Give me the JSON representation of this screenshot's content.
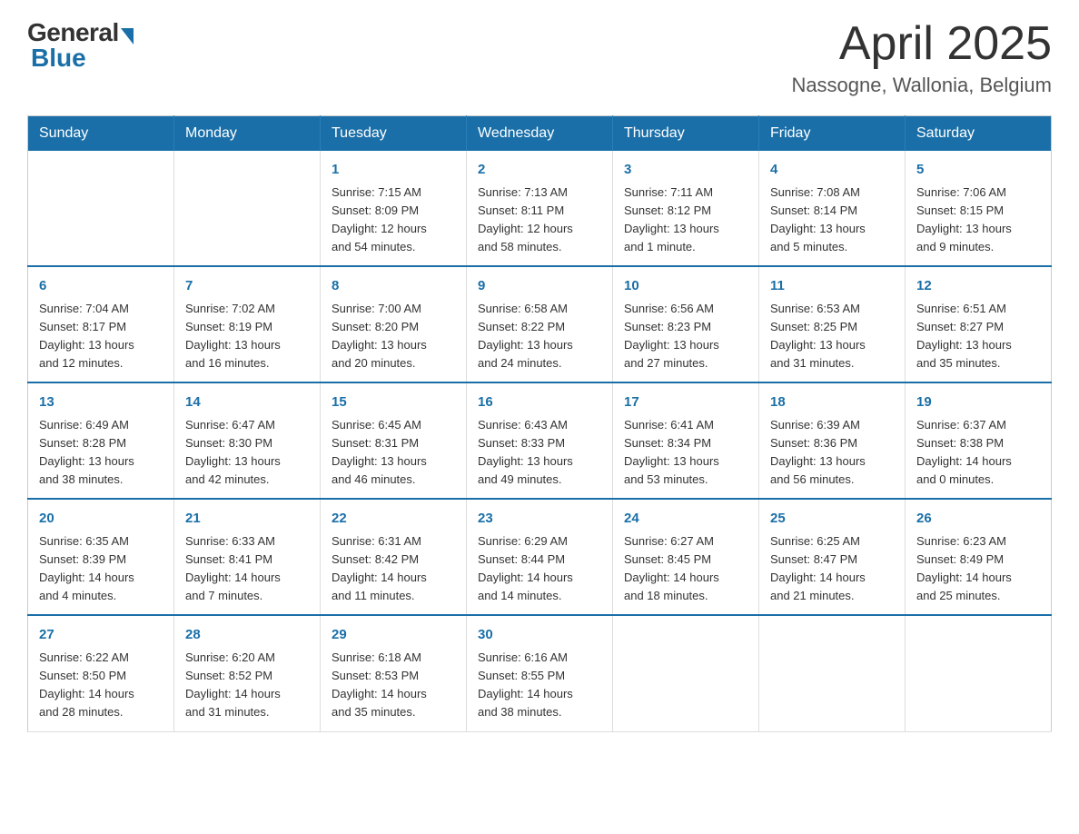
{
  "logo": {
    "general": "General",
    "blue": "Blue"
  },
  "title": "April 2025",
  "location": "Nassogne, Wallonia, Belgium",
  "weekdays": [
    "Sunday",
    "Monday",
    "Tuesday",
    "Wednesday",
    "Thursday",
    "Friday",
    "Saturday"
  ],
  "weeks": [
    [
      {
        "day": "",
        "info": ""
      },
      {
        "day": "",
        "info": ""
      },
      {
        "day": "1",
        "info": "Sunrise: 7:15 AM\nSunset: 8:09 PM\nDaylight: 12 hours\nand 54 minutes."
      },
      {
        "day": "2",
        "info": "Sunrise: 7:13 AM\nSunset: 8:11 PM\nDaylight: 12 hours\nand 58 minutes."
      },
      {
        "day": "3",
        "info": "Sunrise: 7:11 AM\nSunset: 8:12 PM\nDaylight: 13 hours\nand 1 minute."
      },
      {
        "day": "4",
        "info": "Sunrise: 7:08 AM\nSunset: 8:14 PM\nDaylight: 13 hours\nand 5 minutes."
      },
      {
        "day": "5",
        "info": "Sunrise: 7:06 AM\nSunset: 8:15 PM\nDaylight: 13 hours\nand 9 minutes."
      }
    ],
    [
      {
        "day": "6",
        "info": "Sunrise: 7:04 AM\nSunset: 8:17 PM\nDaylight: 13 hours\nand 12 minutes."
      },
      {
        "day": "7",
        "info": "Sunrise: 7:02 AM\nSunset: 8:19 PM\nDaylight: 13 hours\nand 16 minutes."
      },
      {
        "day": "8",
        "info": "Sunrise: 7:00 AM\nSunset: 8:20 PM\nDaylight: 13 hours\nand 20 minutes."
      },
      {
        "day": "9",
        "info": "Sunrise: 6:58 AM\nSunset: 8:22 PM\nDaylight: 13 hours\nand 24 minutes."
      },
      {
        "day": "10",
        "info": "Sunrise: 6:56 AM\nSunset: 8:23 PM\nDaylight: 13 hours\nand 27 minutes."
      },
      {
        "day": "11",
        "info": "Sunrise: 6:53 AM\nSunset: 8:25 PM\nDaylight: 13 hours\nand 31 minutes."
      },
      {
        "day": "12",
        "info": "Sunrise: 6:51 AM\nSunset: 8:27 PM\nDaylight: 13 hours\nand 35 minutes."
      }
    ],
    [
      {
        "day": "13",
        "info": "Sunrise: 6:49 AM\nSunset: 8:28 PM\nDaylight: 13 hours\nand 38 minutes."
      },
      {
        "day": "14",
        "info": "Sunrise: 6:47 AM\nSunset: 8:30 PM\nDaylight: 13 hours\nand 42 minutes."
      },
      {
        "day": "15",
        "info": "Sunrise: 6:45 AM\nSunset: 8:31 PM\nDaylight: 13 hours\nand 46 minutes."
      },
      {
        "day": "16",
        "info": "Sunrise: 6:43 AM\nSunset: 8:33 PM\nDaylight: 13 hours\nand 49 minutes."
      },
      {
        "day": "17",
        "info": "Sunrise: 6:41 AM\nSunset: 8:34 PM\nDaylight: 13 hours\nand 53 minutes."
      },
      {
        "day": "18",
        "info": "Sunrise: 6:39 AM\nSunset: 8:36 PM\nDaylight: 13 hours\nand 56 minutes."
      },
      {
        "day": "19",
        "info": "Sunrise: 6:37 AM\nSunset: 8:38 PM\nDaylight: 14 hours\nand 0 minutes."
      }
    ],
    [
      {
        "day": "20",
        "info": "Sunrise: 6:35 AM\nSunset: 8:39 PM\nDaylight: 14 hours\nand 4 minutes."
      },
      {
        "day": "21",
        "info": "Sunrise: 6:33 AM\nSunset: 8:41 PM\nDaylight: 14 hours\nand 7 minutes."
      },
      {
        "day": "22",
        "info": "Sunrise: 6:31 AM\nSunset: 8:42 PM\nDaylight: 14 hours\nand 11 minutes."
      },
      {
        "day": "23",
        "info": "Sunrise: 6:29 AM\nSunset: 8:44 PM\nDaylight: 14 hours\nand 14 minutes."
      },
      {
        "day": "24",
        "info": "Sunrise: 6:27 AM\nSunset: 8:45 PM\nDaylight: 14 hours\nand 18 minutes."
      },
      {
        "day": "25",
        "info": "Sunrise: 6:25 AM\nSunset: 8:47 PM\nDaylight: 14 hours\nand 21 minutes."
      },
      {
        "day": "26",
        "info": "Sunrise: 6:23 AM\nSunset: 8:49 PM\nDaylight: 14 hours\nand 25 minutes."
      }
    ],
    [
      {
        "day": "27",
        "info": "Sunrise: 6:22 AM\nSunset: 8:50 PM\nDaylight: 14 hours\nand 28 minutes."
      },
      {
        "day": "28",
        "info": "Sunrise: 6:20 AM\nSunset: 8:52 PM\nDaylight: 14 hours\nand 31 minutes."
      },
      {
        "day": "29",
        "info": "Sunrise: 6:18 AM\nSunset: 8:53 PM\nDaylight: 14 hours\nand 35 minutes."
      },
      {
        "day": "30",
        "info": "Sunrise: 6:16 AM\nSunset: 8:55 PM\nDaylight: 14 hours\nand 38 minutes."
      },
      {
        "day": "",
        "info": ""
      },
      {
        "day": "",
        "info": ""
      },
      {
        "day": "",
        "info": ""
      }
    ]
  ]
}
